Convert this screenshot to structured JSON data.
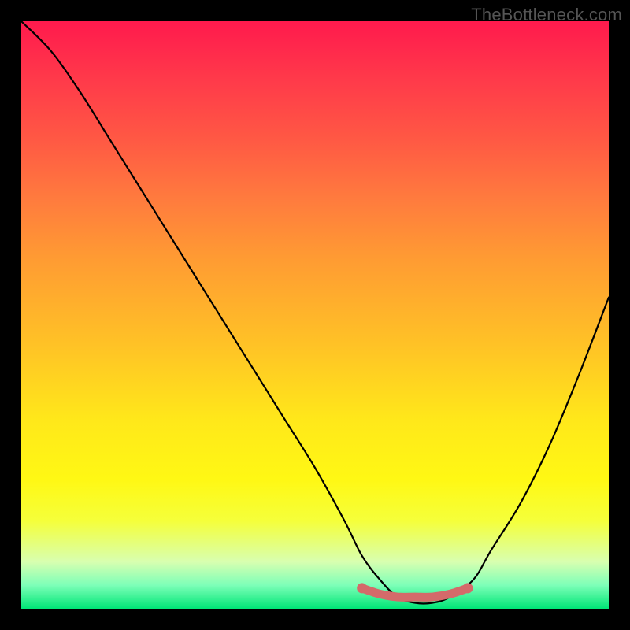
{
  "watermark": "TheBottleneck.com",
  "chart_data": {
    "type": "line",
    "title": "",
    "xlabel": "",
    "ylabel": "",
    "xlim": [
      0,
      100
    ],
    "ylim": [
      0,
      100
    ],
    "grid": false,
    "legend": false,
    "series": [
      {
        "name": "curve",
        "color": "#000000",
        "x": [
          0,
          5,
          10,
          15,
          20,
          25,
          30,
          35,
          40,
          45,
          50,
          55,
          58,
          61,
          64,
          67,
          70,
          73,
          77,
          80,
          85,
          90,
          95,
          100
        ],
        "y": [
          100,
          95,
          88,
          80,
          72,
          64,
          56,
          48,
          40,
          32,
          24,
          15,
          9,
          5,
          2,
          1,
          1,
          2,
          5,
          10,
          18,
          28,
          40,
          53
        ]
      },
      {
        "name": "highlight",
        "color": "#d46a6a",
        "x": [
          58,
          61,
          64,
          67,
          70,
          73,
          76
        ],
        "y": [
          3.5,
          2.5,
          2,
          2,
          2,
          2.5,
          3.5
        ]
      }
    ],
    "background_gradient": {
      "top": "#ff1a4d",
      "mid": "#ffe81a",
      "bottom": "#00e676"
    }
  },
  "area": {
    "outer_w": 800,
    "outer_h": 800,
    "inner_x": 27,
    "inner_y": 27,
    "inner_w": 746,
    "inner_h": 746
  }
}
